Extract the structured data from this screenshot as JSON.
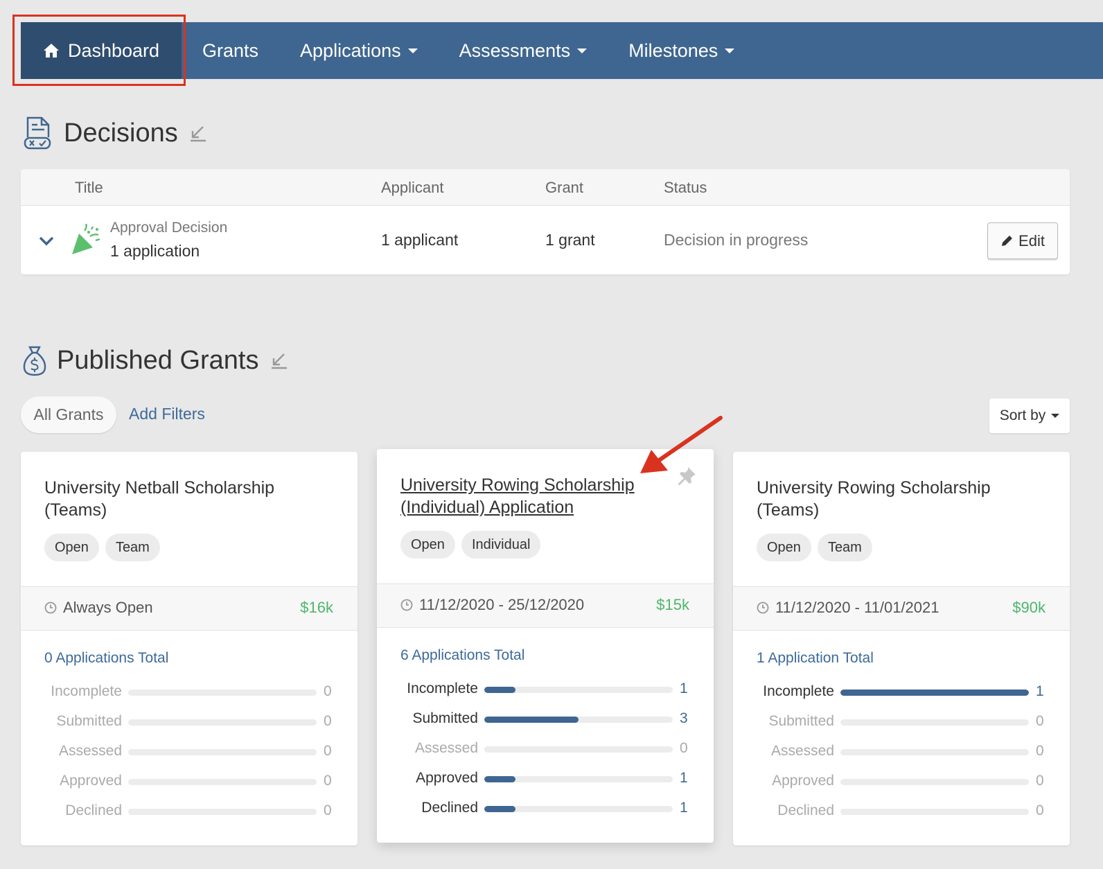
{
  "nav": {
    "items": [
      {
        "label": "Dashboard",
        "icon": "home-icon",
        "active": true,
        "dropdown": false
      },
      {
        "label": "Grants",
        "dropdown": false
      },
      {
        "label": "Applications",
        "dropdown": true
      },
      {
        "label": "Assessments",
        "dropdown": true
      },
      {
        "label": "Milestones",
        "dropdown": true
      }
    ],
    "bg_color": "#3f6690",
    "active_color": "#2f4d6e"
  },
  "decisions": {
    "title": "Decisions",
    "icon": "decision-document-icon",
    "columns": [
      "Title",
      "Applicant",
      "Grant",
      "Status"
    ],
    "rows": [
      {
        "type": "Approval Decision",
        "applications": "1 application",
        "applicant": "1 applicant",
        "grant": "1 grant",
        "status": "Decision in progress",
        "action": "Edit"
      }
    ]
  },
  "published": {
    "title": "Published Grants",
    "icon": "money-bag-icon",
    "filter_all": "All Grants",
    "add_filters": "Add Filters",
    "sort": "Sort by"
  },
  "grants": [
    {
      "title": "University Netball Scholarship (Teams)",
      "tags": [
        "Open",
        "Team"
      ],
      "dates": "Always Open",
      "amount": "$16k",
      "total": "0 Applications Total",
      "stats": [
        {
          "label": "Incomplete",
          "count": "0",
          "fraction": 0
        },
        {
          "label": "Submitted",
          "count": "0",
          "fraction": 0
        },
        {
          "label": "Assessed",
          "count": "0",
          "fraction": 0
        },
        {
          "label": "Approved",
          "count": "0",
          "fraction": 0
        },
        {
          "label": "Declined",
          "count": "0",
          "fraction": 0
        }
      ]
    },
    {
      "title": "University Rowing Scholarship (Individual) Application",
      "tags": [
        "Open",
        "Individual"
      ],
      "dates": "11/12/2020 - 25/12/2020",
      "amount": "$15k",
      "total": "6 Applications Total",
      "stats": [
        {
          "label": "Incomplete",
          "count": "1",
          "fraction": 0.167
        },
        {
          "label": "Submitted",
          "count": "3",
          "fraction": 0.5
        },
        {
          "label": "Assessed",
          "count": "0",
          "fraction": 0
        },
        {
          "label": "Approved",
          "count": "1",
          "fraction": 0.167
        },
        {
          "label": "Declined",
          "count": "1",
          "fraction": 0.167
        }
      ]
    },
    {
      "title": "University Rowing Scholarship (Teams)",
      "tags": [
        "Open",
        "Team"
      ],
      "dates": "11/12/2020 - 11/01/2021",
      "amount": "$90k",
      "total": "1 Application Total",
      "stats": [
        {
          "label": "Incomplete",
          "count": "1",
          "fraction": 1
        },
        {
          "label": "Submitted",
          "count": "0",
          "fraction": 0
        },
        {
          "label": "Assessed",
          "count": "0",
          "fraction": 0
        },
        {
          "label": "Approved",
          "count": "0",
          "fraction": 0
        },
        {
          "label": "Declined",
          "count": "0",
          "fraction": 0
        }
      ]
    }
  ],
  "colors": {
    "accent": "#3f6690",
    "link": "#3d6a99",
    "amount": "#4db66b",
    "annotation": "#d9331f"
  }
}
